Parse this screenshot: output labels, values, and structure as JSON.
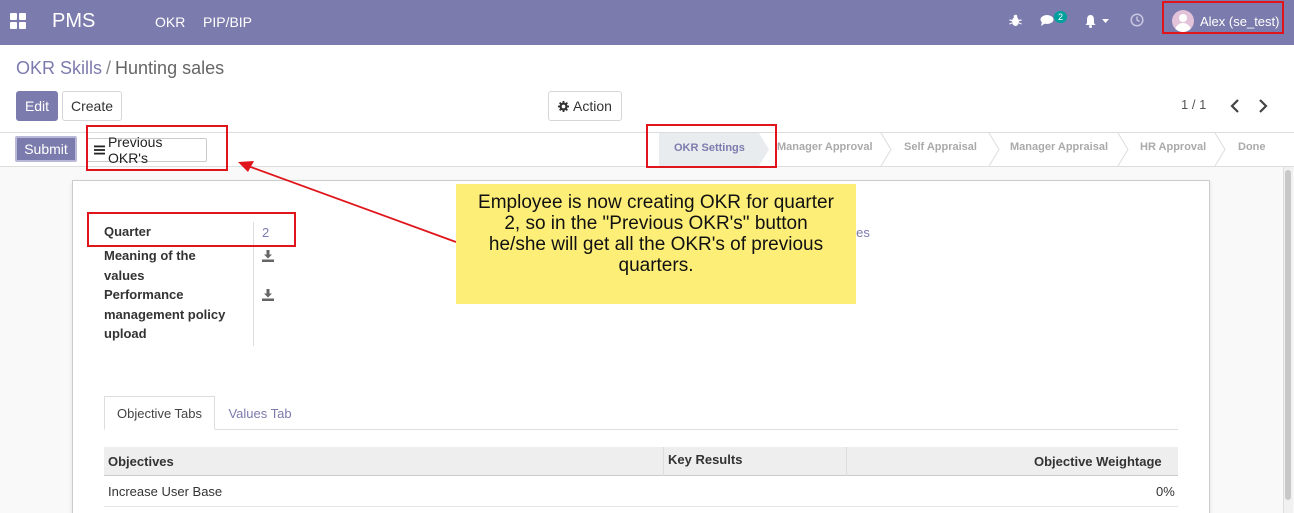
{
  "navbar": {
    "brand": "PMS",
    "menu": [
      "OKR",
      "PIP/BIP"
    ],
    "messages_count": "2",
    "user_name": "Alex (se_test)",
    "bg_color": "#7c7bad"
  },
  "breadcrumb": {
    "parent": "OKR Skills",
    "separator": "/",
    "current": "Hunting sales"
  },
  "toolbar": {
    "edit_label": "Edit",
    "create_label": "Create",
    "action_label": "Action",
    "pager": "1 / 1"
  },
  "statusbar": {
    "submit_label": "Submit",
    "previous_okrs_label": "Previous OKR's",
    "stages": [
      "OKR Settings",
      "Manager Approval",
      "Self Appraisal",
      "Manager Appraisal",
      "HR Approval",
      "Done"
    ],
    "active_stage": "OKR Settings"
  },
  "form": {
    "quarter_label": "Quarter",
    "quarter_value": "2",
    "meaning_label_1": "Meaning of the",
    "meaning_label_2": "values",
    "policy_label_1": "Performance",
    "policy_label_2": "management policy",
    "policy_label_3": "upload",
    "partial_right_text": "ales"
  },
  "tabs": [
    "Objective Tabs",
    "Values Tab"
  ],
  "table": {
    "headers": [
      "Objectives",
      "Key Results",
      "Objective Weightage"
    ],
    "rows": [
      {
        "objective": "Increase User Base",
        "key_results": "",
        "weightage": "0%"
      }
    ]
  },
  "annotation": {
    "note": "Employee is now creating OKR for quarter 2, so in the \"Previous OKR's\" button he/she will get all the OKR's of previous quarters.",
    "color": "#fdee78",
    "highlight_color": "#e0151b"
  }
}
